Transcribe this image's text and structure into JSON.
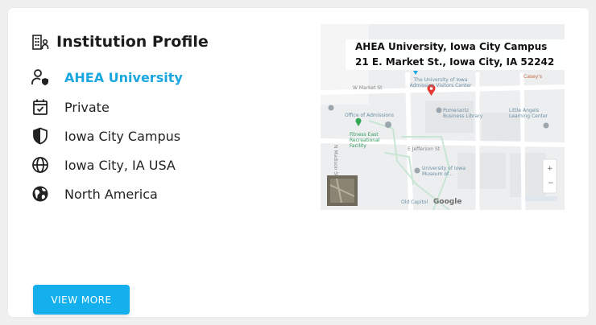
{
  "card": {
    "title": "Institution Profile",
    "title_icon": "building-person-icon",
    "institution_name": "AHEA University",
    "type": "Private",
    "campus": "Iowa City Campus",
    "city": "Iowa City, IA USA",
    "region": "North America",
    "view_more_label": "VIEW MORE"
  },
  "map": {
    "address_line_1": "AHEA University, Iowa City Campus",
    "address_line_2": "21 E. Market St., Iowa City, IA 52242",
    "labels": {
      "visitors_center": "The University of Iowa Admission Visitors Center",
      "market_st": "W Market St",
      "pomerantz": "Pomerantz Business Library",
      "little_angels": "Little Angels Learning Center",
      "office_admissions": "Office of Admissions",
      "fitness": "Fitness East Recreational Facility",
      "jefferson": "E Jefferson St",
      "madison": "N Madison St",
      "museum": "University of Iowa Museum of...",
      "old_capitol": "Old Capitol",
      "caseys": "Casey's",
      "google": "Google"
    }
  },
  "colors": {
    "accent": "#14b0ee",
    "link": "#1aa7e0",
    "pin_red": "#e53935",
    "map_green": "#34a853"
  }
}
